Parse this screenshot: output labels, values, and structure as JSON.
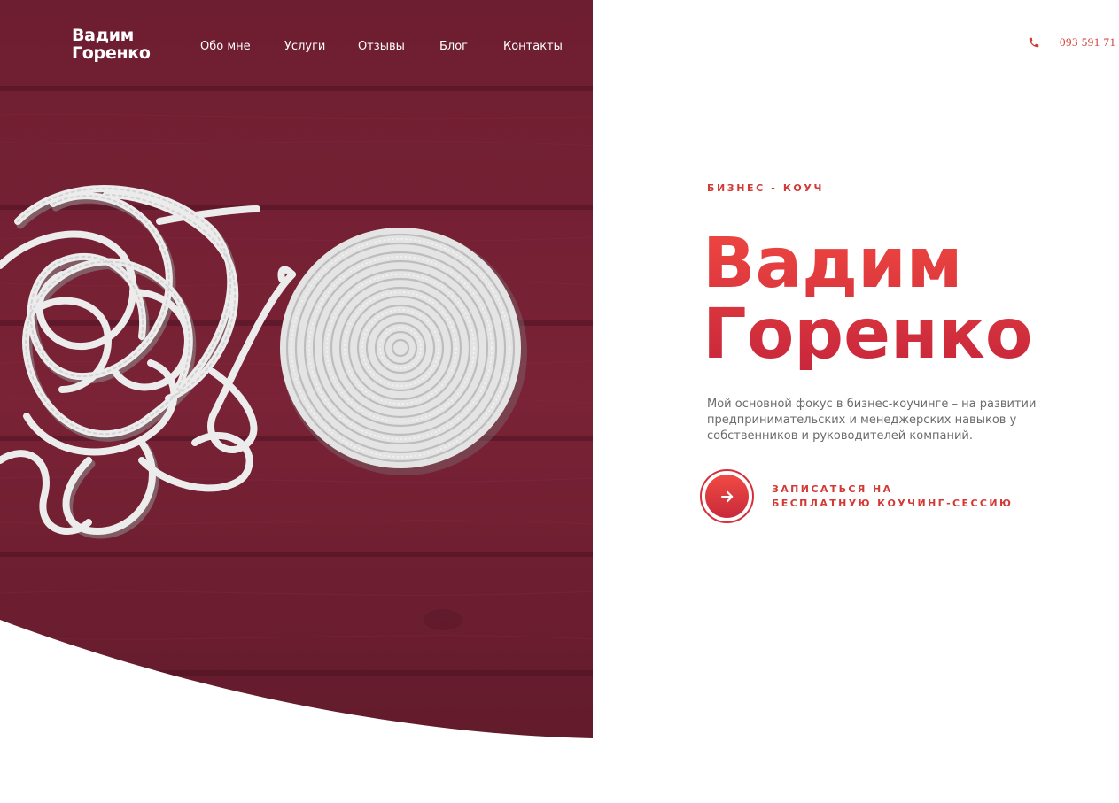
{
  "header": {
    "logo_line1": "Вадим",
    "logo_line2": "Горенко",
    "nav": [
      {
        "label": "Обо мне"
      },
      {
        "label": "Услуги"
      },
      {
        "label": "Отзывы"
      },
      {
        "label": "Блог"
      },
      {
        "label": "Контакты"
      }
    ],
    "phone": "093 591 71",
    "phone_icon": "phone-icon"
  },
  "hero": {
    "eyebrow": "БИЗНЕС - КОУЧ",
    "title_line1": "Вадим",
    "title_line2": "Горенко",
    "description": "Мой основной фокус в бизнес-коучинге – на развитии предпринимательских и менеджерских навыков у собственников и руководителей компаний.",
    "cta_line1": "ЗАПИСАТЬСЯ НА",
    "cta_line2": "БЕСПЛАТНУЮ КОУЧИНГ-СЕССИЮ",
    "cta_icon": "arrow-right-icon"
  },
  "colors": {
    "accent": "#e0353b",
    "wood": "#7b2236",
    "text_muted": "#6b6b6b"
  }
}
